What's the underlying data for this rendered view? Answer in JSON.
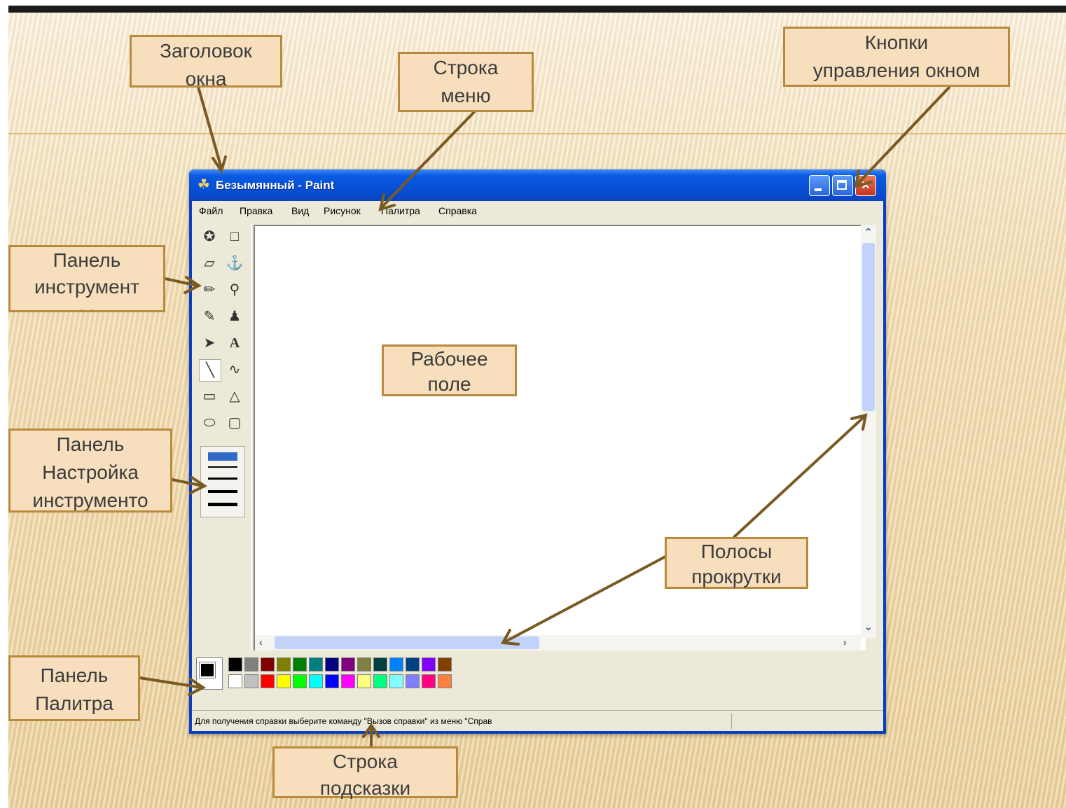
{
  "window": {
    "title": "Безымянный - Paint",
    "menu": [
      "Файл",
      "Правка",
      "Вид",
      "Рисунок",
      "Палитра",
      "Справка"
    ],
    "status": "Для получения справки выберите команду \"Вызов справки\" из меню \"Справ"
  },
  "callouts": {
    "title_bar": "Заголовок\nокна",
    "menu_bar": "Строка\nменю",
    "window_controls": "Кнопки\nуправления окном",
    "toolbox": "Панель\nинструмент\nы",
    "tool_settings": "Панель\nНастройка\nинструменто\nв",
    "palette": "Панель\nПалитра",
    "work_area": "Рабочее\nполе",
    "scrollbars": "Полосы\nпрокрутки",
    "status_bar": "Строка\nподсказки"
  },
  "colors": {
    "accent": "#b98a3d",
    "callout_fill": "#f7dfbd",
    "titlebar": "#0650d6",
    "palette_top": [
      "#000000",
      "#808080",
      "#800000",
      "#808000",
      "#008000",
      "#008080",
      "#000080",
      "#800080",
      "#808040",
      "#004040",
      "#0080ff",
      "#004080",
      "#8000ff",
      "#804000"
    ],
    "palette_bottom": [
      "#ffffff",
      "#c0c0c0",
      "#ff0000",
      "#ffff00",
      "#00ff00",
      "#00ffff",
      "#0000ff",
      "#ff00ff",
      "#ffff80",
      "#00ff80",
      "#80ffff",
      "#8080ff",
      "#ff0080",
      "#ff8040"
    ]
  },
  "icons": [
    "free-select-icon",
    "rect-select-icon",
    "eraser-icon",
    "fill-icon",
    "color-picker-icon",
    "magnifier-icon",
    "pencil-icon",
    "brush-icon",
    "airbrush-icon",
    "text-icon",
    "line-icon",
    "curve-icon",
    "rectangle-icon",
    "polygon-icon",
    "ellipse-icon",
    "rounded-rect-icon"
  ]
}
